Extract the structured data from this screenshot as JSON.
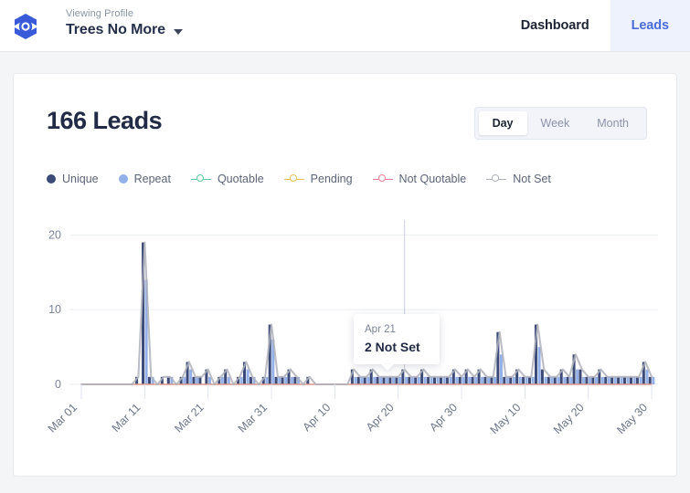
{
  "header": {
    "logo_icon": "hexagon-logo-icon",
    "profile_label": "Viewing Profile",
    "profile_name": "Trees No More",
    "caret_icon": "chevron-down-icon",
    "nav": [
      {
        "label": "Dashboard",
        "active": false
      },
      {
        "label": "Leads",
        "active": true
      }
    ]
  },
  "card": {
    "title": "166 Leads",
    "range_options": [
      {
        "label": "Day",
        "active": true
      },
      {
        "label": "Week",
        "active": false
      },
      {
        "label": "Month",
        "active": false
      }
    ]
  },
  "tooltip": {
    "date": "Apr 21",
    "value": "2 Not Set"
  },
  "colors": {
    "unique": "#3c4a78",
    "repeat": "#94b0e8",
    "quotable": "#5ec9a0",
    "pending": "#e8c15a",
    "not_quotable": "#ec7f94",
    "not_set": "#b0b2bb",
    "accent": "#4a6bd8",
    "title": "#222b45",
    "grid": "#eceef3"
  },
  "chart_data": {
    "type": "bar",
    "title": "166 Leads",
    "xlabel": "",
    "ylabel": "",
    "ylim": [
      0,
      22
    ],
    "yticks": [
      0,
      10,
      20
    ],
    "grid": true,
    "legend_position": "top-left",
    "xtick_labels": [
      "Mar 01",
      "Mar 11",
      "Mar 21",
      "Mar 31",
      "Apr 10",
      "Apr 20",
      "Apr 30",
      "May 10",
      "May 20",
      "May 30"
    ],
    "xtick_indices": [
      0,
      10,
      20,
      30,
      40,
      50,
      60,
      70,
      80,
      90
    ],
    "x": [
      "Mar 01",
      "Mar 02",
      "Mar 03",
      "Mar 04",
      "Mar 05",
      "Mar 06",
      "Mar 07",
      "Mar 08",
      "Mar 09",
      "Mar 10",
      "Mar 11",
      "Mar 12",
      "Mar 13",
      "Mar 14",
      "Mar 15",
      "Mar 16",
      "Mar 17",
      "Mar 18",
      "Mar 19",
      "Mar 20",
      "Mar 21",
      "Mar 22",
      "Mar 23",
      "Mar 24",
      "Mar 25",
      "Mar 26",
      "Mar 27",
      "Mar 28",
      "Mar 29",
      "Mar 30",
      "Mar 31",
      "Apr 01",
      "Apr 02",
      "Apr 03",
      "Apr 04",
      "Apr 05",
      "Apr 06",
      "Apr 07",
      "Apr 08",
      "Apr 09",
      "Apr 10",
      "Apr 11",
      "Apr 12",
      "Apr 13",
      "Apr 14",
      "Apr 15",
      "Apr 16",
      "Apr 17",
      "Apr 18",
      "Apr 19",
      "Apr 20",
      "Apr 21",
      "Apr 22",
      "Apr 23",
      "Apr 24",
      "Apr 25",
      "Apr 26",
      "Apr 27",
      "Apr 28",
      "Apr 29",
      "Apr 30",
      "May 01",
      "May 02",
      "May 03",
      "May 04",
      "May 05",
      "May 06",
      "May 07",
      "May 08",
      "May 09",
      "May 10",
      "May 11",
      "May 12",
      "May 13",
      "May 14",
      "May 15",
      "May 16",
      "May 17",
      "May 18",
      "May 19",
      "May 20",
      "May 21",
      "May 22",
      "May 23",
      "May 24",
      "May 25",
      "May 26",
      "May 27",
      "May 28",
      "May 29",
      "May 30",
      "May 31"
    ],
    "series": [
      {
        "name": "Unique",
        "type": "bar",
        "color": "#3c4a78",
        "values": [
          0,
          0,
          0,
          0,
          0,
          0,
          0,
          0,
          0,
          1,
          19,
          1,
          0,
          1,
          1,
          0,
          1,
          3,
          1,
          1,
          2,
          0,
          1,
          2,
          0,
          1,
          3,
          1,
          0,
          1,
          8,
          1,
          1,
          2,
          1,
          0,
          1,
          0,
          0,
          0,
          0,
          0,
          0,
          2,
          1,
          1,
          2,
          1,
          1,
          1,
          1,
          2,
          1,
          1,
          2,
          1,
          1,
          1,
          1,
          2,
          1,
          2,
          1,
          2,
          1,
          1,
          7,
          1,
          1,
          2,
          1,
          1,
          8,
          2,
          1,
          1,
          2,
          1,
          4,
          2,
          1,
          1,
          2,
          1,
          1,
          1,
          1,
          1,
          1,
          3,
          1
        ]
      },
      {
        "name": "Repeat",
        "type": "bar",
        "color": "#94b0e8",
        "values": [
          0,
          0,
          0,
          0,
          0,
          0,
          0,
          0,
          0,
          0,
          14,
          1,
          0,
          0,
          1,
          0,
          1,
          2,
          1,
          0,
          1,
          0,
          1,
          1,
          0,
          1,
          2,
          1,
          0,
          1,
          6,
          1,
          1,
          1,
          1,
          0,
          0,
          0,
          0,
          0,
          0,
          0,
          0,
          1,
          1,
          1,
          1,
          1,
          1,
          1,
          1,
          1,
          1,
          1,
          1,
          1,
          1,
          1,
          1,
          1,
          1,
          1,
          1,
          1,
          1,
          1,
          4,
          1,
          1,
          1,
          1,
          1,
          5,
          1,
          1,
          1,
          1,
          1,
          2,
          1,
          1,
          1,
          1,
          1,
          1,
          1,
          1,
          1,
          1,
          2,
          1
        ]
      },
      {
        "name": "Quotable",
        "type": "line",
        "color": "#5ec9a0",
        "values": [
          0,
          0,
          0,
          0,
          0,
          0,
          0,
          0,
          0,
          0,
          0,
          0,
          0,
          0,
          0,
          0,
          0,
          0,
          0,
          0,
          0,
          0,
          0,
          0,
          0,
          0,
          0,
          0,
          0,
          0,
          0,
          0,
          0,
          0,
          0,
          0,
          0,
          0,
          0,
          0,
          0,
          0,
          0,
          0,
          0,
          0,
          0,
          0,
          0,
          0,
          0,
          0,
          0,
          0,
          0,
          0,
          0,
          0,
          0,
          0,
          0,
          0,
          0,
          0,
          0,
          0,
          0,
          0,
          0,
          0,
          0,
          0,
          0,
          0,
          0,
          0,
          0,
          0,
          0,
          0,
          0,
          0,
          0,
          0,
          0,
          0,
          0,
          0,
          0,
          0,
          0
        ]
      },
      {
        "name": "Pending",
        "type": "line",
        "color": "#e8c15a",
        "values": [
          0,
          0,
          0,
          0,
          0,
          0,
          0,
          0,
          0,
          0,
          0,
          0,
          0,
          0,
          0,
          0,
          0,
          0,
          0,
          0,
          0,
          0,
          0,
          0,
          0,
          0,
          0,
          0,
          0,
          0,
          0,
          0,
          0,
          0,
          0,
          0,
          0,
          0,
          0,
          0,
          0,
          0,
          0,
          0,
          0,
          0,
          0,
          0,
          0,
          0,
          0,
          0,
          0,
          0,
          0,
          0,
          0,
          0,
          0,
          0,
          0,
          0,
          0,
          0,
          0,
          0,
          0,
          0,
          0,
          0,
          0,
          0,
          0,
          0,
          0,
          0,
          0,
          0,
          0,
          0,
          0,
          0,
          0,
          0,
          0,
          0,
          0,
          0,
          0,
          0,
          0
        ]
      },
      {
        "name": "Not Quotable",
        "type": "line",
        "color": "#ec7f94",
        "values": [
          0,
          0,
          0,
          0,
          0,
          0,
          0,
          0,
          0,
          0,
          0,
          0,
          0,
          0,
          0,
          0,
          0,
          0,
          0,
          0,
          0,
          0,
          0,
          0,
          0,
          0,
          0,
          0,
          0,
          0,
          0,
          0,
          0,
          0,
          0,
          0,
          0,
          0,
          0,
          0,
          0,
          0,
          0,
          0,
          0,
          0,
          0,
          0,
          0,
          0,
          0,
          0,
          0,
          0,
          0,
          0,
          0,
          0,
          0,
          0,
          0,
          0,
          0,
          0,
          0,
          0,
          0,
          0,
          0,
          0,
          0,
          0,
          0,
          0,
          0,
          0,
          0,
          0,
          0,
          0,
          0,
          0,
          0,
          0,
          0,
          0,
          0,
          0,
          0,
          0,
          0
        ]
      },
      {
        "name": "Not Set",
        "type": "line",
        "color": "#b0b2bb",
        "values": [
          0,
          0,
          0,
          0,
          0,
          0,
          0,
          0,
          0,
          1,
          19,
          1,
          0,
          1,
          1,
          0,
          1,
          3,
          1,
          1,
          2,
          0,
          1,
          2,
          0,
          1,
          3,
          1,
          0,
          1,
          8,
          1,
          1,
          2,
          1,
          0,
          1,
          0,
          0,
          0,
          0,
          0,
          0,
          2,
          1,
          1,
          2,
          1,
          1,
          1,
          1,
          2,
          1,
          1,
          2,
          1,
          1,
          1,
          1,
          2,
          1,
          2,
          1,
          2,
          1,
          1,
          7,
          1,
          1,
          2,
          1,
          1,
          8,
          2,
          1,
          1,
          2,
          1,
          4,
          2,
          1,
          1,
          2,
          1,
          1,
          1,
          1,
          1,
          1,
          3,
          1
        ]
      }
    ]
  }
}
